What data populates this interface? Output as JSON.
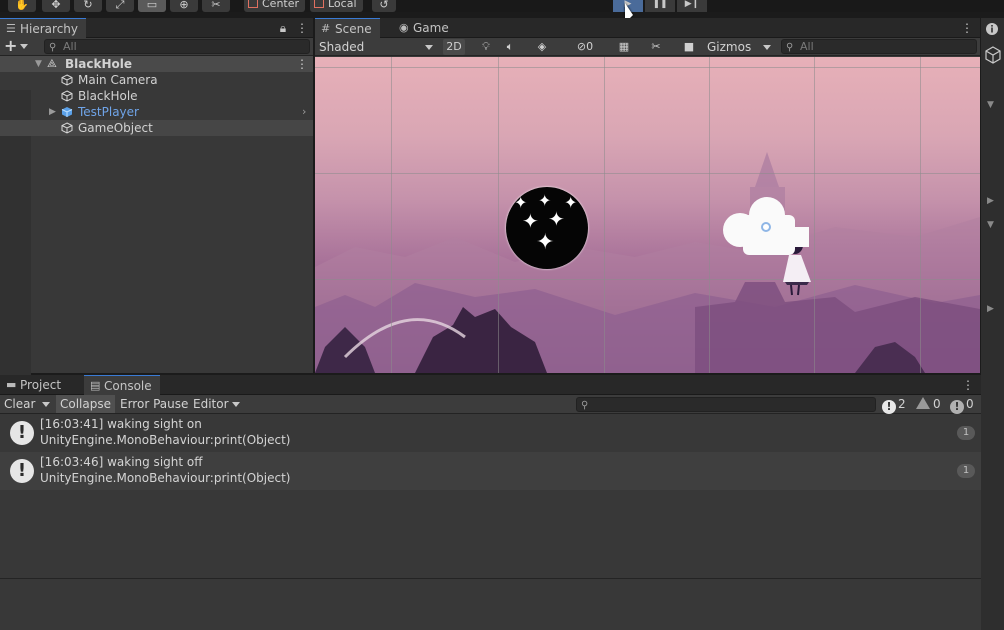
{
  "toolbar": {
    "tools": [
      "hand-tool",
      "move-tool",
      "rotate-tool",
      "scale-tool",
      "rect-tool",
      "transform-tool",
      "custom-tool"
    ],
    "pivot_label": "Center",
    "space_label": "Local",
    "play_glyphs": {
      "play": "▶",
      "pause": "❚❚",
      "step": "▶❙"
    }
  },
  "hierarchy": {
    "tab_label": "Hierarchy",
    "add_label": "+",
    "search_placeholder": "All",
    "scene_name": "BlackHole",
    "items": [
      {
        "label": "Main Camera"
      },
      {
        "label": "BlackHole"
      },
      {
        "label": "TestPlayer"
      },
      {
        "label": "GameObject"
      }
    ]
  },
  "scene": {
    "tabs": [
      {
        "label": "Scene"
      },
      {
        "label": "Game"
      }
    ],
    "shading_mode": "Shaded",
    "mode_2d": "2D",
    "fx_count": "0",
    "gizmos_label": "Gizmos",
    "search_placeholder": "All"
  },
  "console": {
    "tabs": [
      {
        "label": "Project"
      },
      {
        "label": "Console"
      }
    ],
    "buttons": {
      "clear": "Clear",
      "collapse": "Collapse",
      "error_pause": "Error Pause",
      "editor": "Editor"
    },
    "counts": {
      "info": "2",
      "warning": "0",
      "error": "0"
    },
    "logs": [
      {
        "line1": "[16:03:41] waking sight on",
        "line2": "UnityEngine.MonoBehaviour:print(Object)",
        "count": "1"
      },
      {
        "line1": "[16:03:46] waking sight off",
        "line2": "UnityEngine.MonoBehaviour:print(Object)",
        "count": "1"
      }
    ]
  },
  "colors": {
    "accent": "#3a7bd5",
    "prefab_text": "#6fa4e8",
    "sky_top": "#e7b0b8",
    "sky_bottom": "#714873"
  }
}
